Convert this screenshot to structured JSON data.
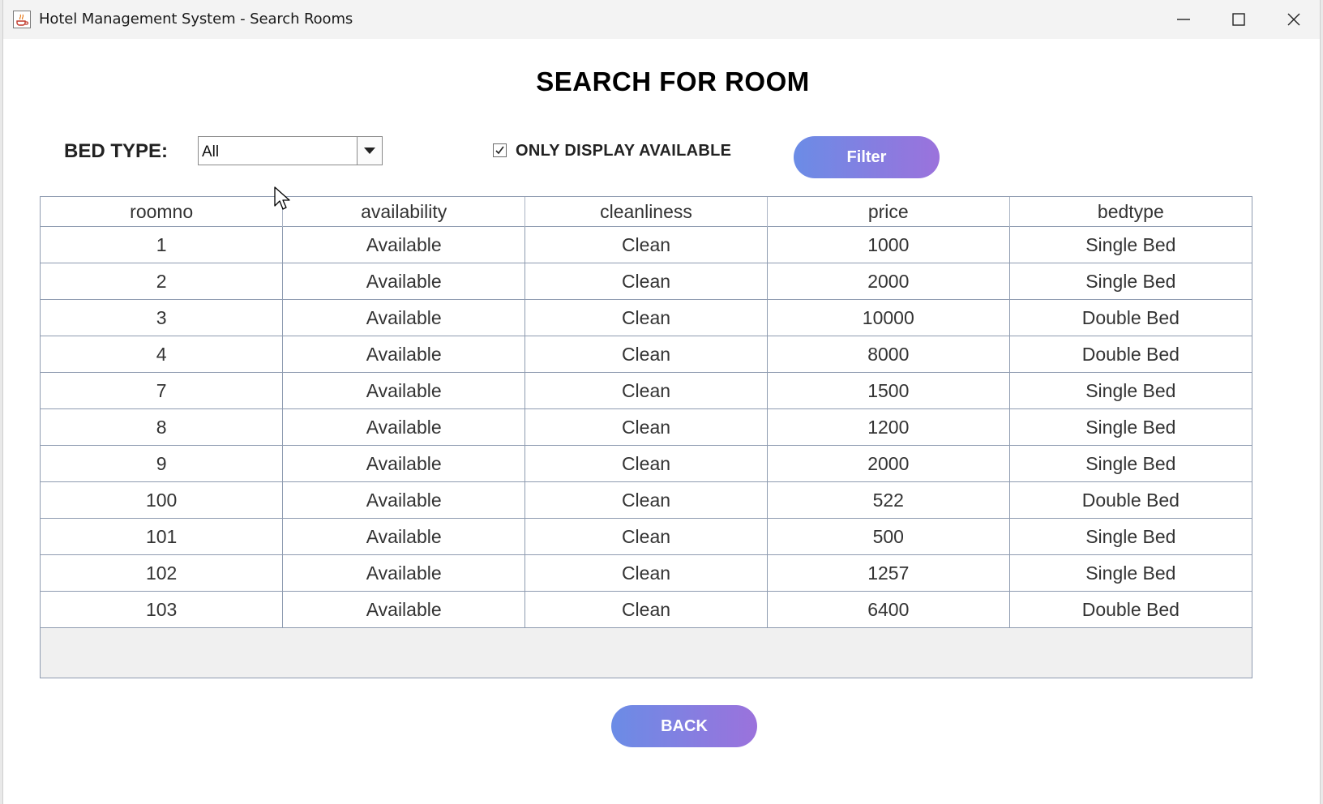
{
  "window": {
    "title": "Hotel Management System - Search Rooms"
  },
  "page": {
    "title": "SEARCH FOR ROOM"
  },
  "filters": {
    "bed_type_label": "BED TYPE:",
    "bed_type_value": "All",
    "only_available_label": "ONLY DISPLAY AVAILABLE",
    "only_available_checked": true,
    "filter_button": "Filter"
  },
  "table": {
    "columns": [
      "roomno",
      "availability",
      "cleanliness",
      "price",
      "bedtype"
    ],
    "rows": [
      [
        "1",
        "Available",
        "Clean",
        "1000",
        "Single Bed"
      ],
      [
        "2",
        "Available",
        "Clean",
        "2000",
        "Single Bed"
      ],
      [
        "3",
        "Available",
        "Clean",
        "10000",
        "Double Bed"
      ],
      [
        "4",
        "Available",
        "Clean",
        "8000",
        "Double Bed"
      ],
      [
        "7",
        "Available",
        "Clean",
        "1500",
        "Single Bed"
      ],
      [
        "8",
        "Available",
        "Clean",
        "1200",
        "Single Bed"
      ],
      [
        "9",
        "Available",
        "Clean",
        "2000",
        "Single Bed"
      ],
      [
        "100",
        "Available",
        "Clean",
        "522",
        "Double Bed"
      ],
      [
        "101",
        "Available",
        "Clean",
        "500",
        "Single Bed"
      ],
      [
        "102",
        "Available",
        "Clean",
        "1257",
        "Single Bed"
      ],
      [
        "103",
        "Available",
        "Clean",
        "6400",
        "Double Bed"
      ]
    ]
  },
  "footer": {
    "back_button": "BACK"
  },
  "colors": {
    "button_gradient_start": "#6b8ce6",
    "button_gradient_end": "#9b72dc",
    "grid_line": "#8e9bb0"
  },
  "icons": {
    "app": "java-cup-icon",
    "minimize": "minimize-icon",
    "maximize": "maximize-icon",
    "close": "close-icon",
    "dropdown": "caret-down-icon",
    "checkbox": "checkmark-icon",
    "cursor": "mouse-pointer-icon"
  }
}
